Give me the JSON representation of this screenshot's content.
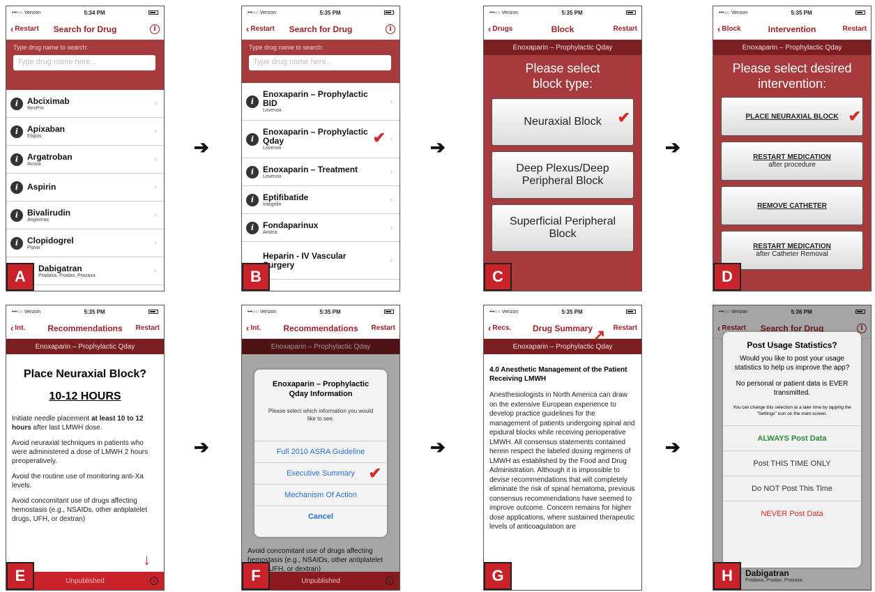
{
  "status": {
    "carrier": "•••○○ Verizon",
    "times": [
      "5:34 PM",
      "5:35 PM",
      "5:35 PM",
      "5:35 PM",
      "5:35 PM",
      "5:35 PM",
      "5:35 PM",
      "5:36 PM"
    ]
  },
  "arrow": "➔",
  "check": "✔",
  "redarrow_right": "↗",
  "redarrow_down": "↓",
  "info_glyph": "i",
  "chev": "›",
  "A": {
    "label": "A",
    "nav": {
      "back": "Restart",
      "title": "Search for Drug"
    },
    "search_label": "Type drug name to search:",
    "placeholder": "Type drug name here...",
    "drugs": [
      {
        "name": "Abciximab",
        "brand": "ReoPro"
      },
      {
        "name": "Apixaban",
        "brand": "Eliquis"
      },
      {
        "name": "Argatroban",
        "brand": "Acova"
      },
      {
        "name": "Aspirin",
        "brand": ""
      },
      {
        "name": "Bivalirudin",
        "brand": "Angiomax"
      },
      {
        "name": "Clopidogrel",
        "brand": "Plavix"
      },
      {
        "name": "Dabigatran",
        "brand": "Pradaxa, Pradax, Prazaxa"
      }
    ]
  },
  "B": {
    "label": "B",
    "nav": {
      "back": "Restart",
      "title": "Search for Drug"
    },
    "search_label": "Type drug name to search:",
    "placeholder": "Type drug name here...",
    "drugs": [
      {
        "name": "Enoxaparin – Prophylactic BID",
        "brand": "Lovenox"
      },
      {
        "name": "Enoxaparin – Prophylactic Qday",
        "brand": "Lovenox"
      },
      {
        "name": "Enoxaparin – Treatment",
        "brand": "Lovenox"
      },
      {
        "name": "Eptifibatide",
        "brand": "Integrilin"
      },
      {
        "name": "Fondaparinux",
        "brand": "Arixtra"
      },
      {
        "name": "Heparin - IV Vascular Surgery",
        "brand": ""
      }
    ]
  },
  "C": {
    "label": "C",
    "nav": {
      "back": "Drugs",
      "title": "Block",
      "right": "Restart"
    },
    "banner": "Enoxaparin – Prophylactic Qday",
    "prompt": "Please select block type:",
    "buttons": [
      "Neuraxial Block",
      "Deep Plexus/Deep Peripheral Block",
      "Superficial Peripheral Block"
    ]
  },
  "D": {
    "label": "D",
    "nav": {
      "back": "Block",
      "title": "Intervention",
      "right": "Restart"
    },
    "banner": "Enoxaparin – Prophylactic Qday",
    "prompt": "Please select desired intervention:",
    "buttons": [
      {
        "main": "PLACE NEURAXIAL BLOCK",
        "sub": ""
      },
      {
        "main": "RESTART MEDICATION",
        "sub": "after procedure"
      },
      {
        "main": "REMOVE CATHETER",
        "sub": ""
      },
      {
        "main": "RESTART MEDICATION",
        "sub": "after Catheter Removal"
      }
    ]
  },
  "E": {
    "label": "E",
    "nav": {
      "back": "Int.",
      "title": "Recommendations",
      "right": "Restart"
    },
    "banner": "Enoxaparin – Prophylactic Qday",
    "heading": "Place Neuraxial Block?",
    "hours": "10-12 HOURS",
    "p1a": "Initiate needle placement ",
    "p1b": "at least 10 to 12 hours",
    "p1c": " after last LMWH dose.",
    "p2": "Avoid neuraxial techniques in patients who were administered a dose of LMWH 2 hours preoperatively.",
    "p3": "Avoid the routine use of monitoring anti-Xa levels.",
    "p4": "Avoid concomitant use of drugs affecting hemostasis (e.g., NSAIDs, other antiplatelet drugs, UFH, or dextran)",
    "footer": "Unpublished"
  },
  "F": {
    "label": "F",
    "nav": {
      "back": "Int.",
      "title": "Recommendations",
      "right": "Restart"
    },
    "banner": "Enoxaparin – Prophylactic Qday",
    "sheet_title": "Enoxaparin – Prophylactic Qday Information",
    "sheet_sub": "Please select which information you would like to see.",
    "options": [
      "Full 2010 ASRA Guideline",
      "Executive Summary",
      "Mechanism Of Action",
      "Cancel"
    ],
    "bg_text": "Avoid concomitant use of drugs affecting hemostasis (e.g., NSAIDs, other antiplatelet drugs, UFH, or dextran)",
    "footer": "Unpublished"
  },
  "G": {
    "label": "G",
    "nav": {
      "back": "Recs.",
      "title": "Drug Summary",
      "right": "Restart"
    },
    "banner": "Enoxaparin – Prophylactic Qday",
    "heading": "4.0 Anesthetic Management of the Patient Receiving LMWH",
    "body": "Anesthesiologists in North America can draw on the extensive European experience to develop practice guidelines for the management of patients undergoing spinal and epidural blocks while receiving perioperative LMWH. All consensus statements contained herein respect the labeled dosing regimens of LMWH as established by the Food and Drug Administration. Although it is impossible to devise recommendations that will completely eliminate the risk of spinal hematoma, previous consensus recommendations have seemed to improve outcome. Concern remains for higher dose applications, where sustained therapeutic levels of anticoagulation are"
  },
  "H": {
    "label": "H",
    "nav": {
      "back": "Restart",
      "title": "Search for Drug"
    },
    "dlg_title": "Post Usage Statistics?",
    "dlg_q": "Would you like to post your usage statistics to help us improve the app?",
    "dlg_note": "No personal or patient data is EVER transmitted.",
    "dlg_small": "You can change this selection at a later time by tapping the \"Settings\" icon on the main screen.",
    "options": [
      "ALWAYS Post Data",
      "Post THIS TIME ONLY",
      "Do NOT Post This Time",
      "NEVER Post Data"
    ],
    "bottom_drug": {
      "name": "Dabigatran",
      "brand": "Pradaxa, Pradax, Prazaxa"
    },
    "colors": {
      "green": "#2e8b3a",
      "red": "#d62828"
    }
  }
}
